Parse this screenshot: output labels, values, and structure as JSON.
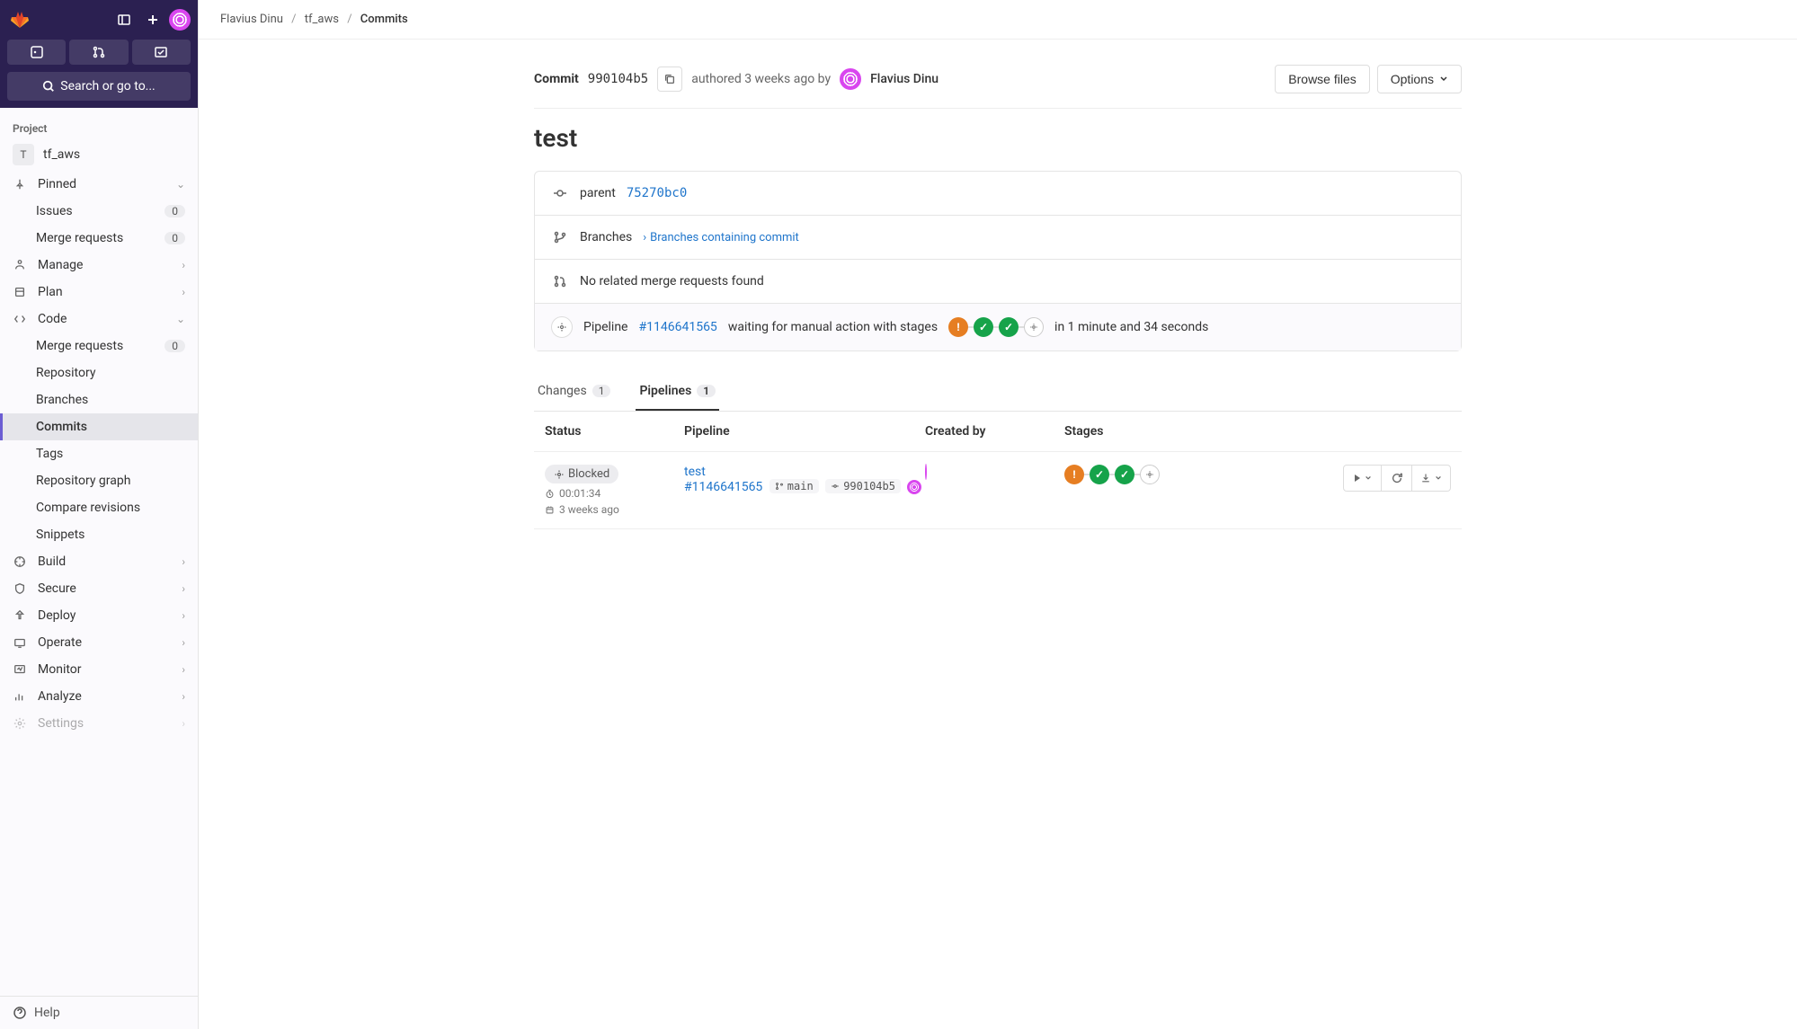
{
  "breadcrumbs": {
    "owner": "Flavius Dinu",
    "project": "tf_aws",
    "current": "Commits"
  },
  "sidebar": {
    "search_label": "Search or go to...",
    "section": "Project",
    "project_initial": "T",
    "project_name": "tf_aws",
    "pinned_label": "Pinned",
    "pinned_items": [
      {
        "label": "Issues",
        "count": "0"
      },
      {
        "label": "Merge requests",
        "count": "0"
      }
    ],
    "nav": [
      {
        "label": "Manage"
      },
      {
        "label": "Plan"
      },
      {
        "label": "Code",
        "expanded": true,
        "children": [
          {
            "label": "Merge requests",
            "count": "0"
          },
          {
            "label": "Repository"
          },
          {
            "label": "Branches"
          },
          {
            "label": "Commits",
            "active": true
          },
          {
            "label": "Tags"
          },
          {
            "label": "Repository graph"
          },
          {
            "label": "Compare revisions"
          },
          {
            "label": "Snippets"
          }
        ]
      },
      {
        "label": "Build"
      },
      {
        "label": "Secure"
      },
      {
        "label": "Deploy"
      },
      {
        "label": "Operate"
      },
      {
        "label": "Monitor"
      },
      {
        "label": "Analyze"
      },
      {
        "label": "Settings"
      }
    ],
    "help": "Help"
  },
  "commit": {
    "label_prefix": "Commit",
    "sha": "990104b5",
    "authored_text": "authored 3 weeks ago by",
    "author": "Flavius Dinu",
    "browse_files": "Browse files",
    "options": "Options",
    "title": "test",
    "parent_label": "parent",
    "parent_sha": "75270bc0",
    "branches_label": "Branches",
    "branches_link": "Branches containing commit",
    "no_mr": "No related merge requests found",
    "pipeline_label": "Pipeline",
    "pipeline_id": "#1146641565",
    "pipeline_status_text": "waiting for manual action with stages",
    "pipeline_duration": "in 1 minute and 34 seconds"
  },
  "tabs": {
    "changes": {
      "label": "Changes",
      "count": "1"
    },
    "pipelines": {
      "label": "Pipelines",
      "count": "1"
    }
  },
  "table": {
    "headers": {
      "status": "Status",
      "pipeline": "Pipeline",
      "created": "Created by",
      "stages": "Stages"
    },
    "row": {
      "status": "Blocked",
      "duration": "00:01:34",
      "age": "3 weeks ago",
      "title": "test",
      "pipeline_id": "#1146641565",
      "ref": "main",
      "sha": "990104b5"
    }
  }
}
